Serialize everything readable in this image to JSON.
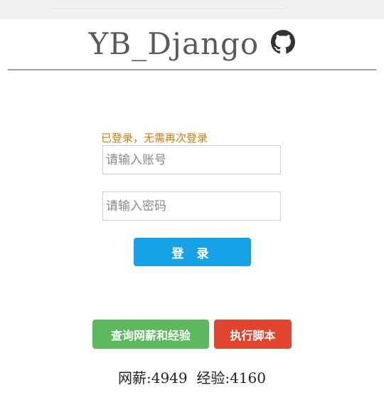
{
  "header": {
    "title": "YB_Django",
    "icon": "github-icon"
  },
  "login": {
    "status_message": "已登录，无需再次登录",
    "account_placeholder": "请输入账号",
    "password_placeholder": "请输入密码",
    "login_label": "登 录"
  },
  "actions": {
    "query_label": "查询网薪和经验",
    "run_label": "执行脚本"
  },
  "stats": {
    "salary_label": "网薪:",
    "salary_value": "4949",
    "exp_label": "经验:",
    "exp_value": "4160"
  },
  "colors": {
    "login_button": "#17a2e8",
    "query_button": "#5cb85c",
    "run_button": "#e2452f",
    "status_text": "#d27a10"
  }
}
